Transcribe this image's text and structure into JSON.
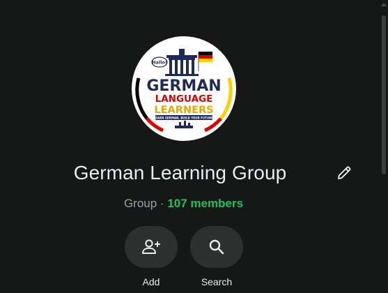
{
  "group": {
    "name": "German Learning Group",
    "type": "Group",
    "separator": "·",
    "members": "107 members"
  },
  "logo": {
    "line1": "GERMAN",
    "line2": "LANGUAGE",
    "line3": "LEARNERS",
    "tagline": "LEARN GERMAN. BUILD YOUR FUTURE.",
    "bubble": "Hallo!"
  },
  "actions": [
    {
      "label": "Add",
      "icon": "add-person-icon"
    },
    {
      "label": "Search",
      "icon": "search-icon"
    }
  ],
  "colors": {
    "accent_green": "#21c063",
    "background": "#161717",
    "button_bg": "#2e2f2f",
    "flag_black": "#000000",
    "flag_red": "#dd0000",
    "flag_gold": "#ffce00",
    "logo_navy": "#1f2a5c"
  }
}
